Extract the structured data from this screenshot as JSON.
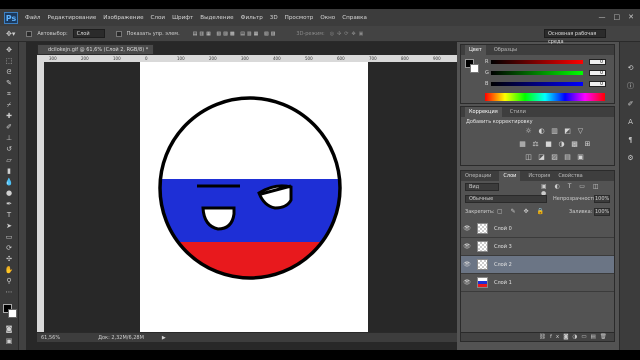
{
  "app": {
    "logo": "Ps",
    "menu": [
      "Файл",
      "Редактирование",
      "Изображение",
      "Слои",
      "Шрифт",
      "Выделение",
      "Фильтр",
      "3D",
      "Просмотр",
      "Окно",
      "Справка"
    ],
    "window_controls": [
      "—",
      "□",
      "✕"
    ]
  },
  "options_bar": {
    "autoselect_label": "Автовыбор:",
    "autoselect_value": "Слой",
    "show_controls_label": "Показать упр. элем.",
    "mode_3d_label": "3D-режим:",
    "workspace": "Основная рабочая среда"
  },
  "document": {
    "tab_title": "dcilokejn.gif @ 61,6% (Слой 2, RGB/8) *",
    "ruler_ticks": [
      "300",
      "200",
      "100",
      "0",
      "100",
      "200",
      "300",
      "400",
      "500",
      "600",
      "700",
      "800",
      "900"
    ],
    "zoom": "61,56%",
    "doc_size": "Док: 2,32M/6,28M"
  },
  "color_panel": {
    "tabs": [
      "Цвет",
      "Образцы"
    ],
    "sliders": [
      {
        "label": "R",
        "value": "0",
        "gradient": "#ff0000"
      },
      {
        "label": "G",
        "value": "0",
        "gradient": "#00ff00"
      },
      {
        "label": "B",
        "value": "0",
        "gradient": "#0000ff"
      }
    ],
    "foreground": "#000000",
    "background": "#ffffff"
  },
  "adjustments_panel": {
    "tabs": [
      "Коррекция",
      "Стили"
    ],
    "subtitle": "Добавить корректировку",
    "icons_row1": [
      "☼",
      "◐",
      "▥",
      "◩",
      "▽"
    ],
    "icons_row2": [
      "▦",
      "⚖",
      "■",
      "◑",
      "▩",
      "⊞"
    ],
    "icons_row3": [
      "◫",
      "◪",
      "▨",
      "▤",
      "▣"
    ]
  },
  "layers_panel": {
    "tabs": [
      "Операции",
      "Слои",
      "История",
      "Свойства"
    ],
    "filter": "Вид",
    "blend_mode": "Обычные",
    "opacity_label": "Непрозрачность:",
    "opacity_value": "100%",
    "lock_label": "Закрепить:",
    "fill_label": "Заливка:",
    "fill_value": "100%",
    "layers": [
      {
        "name": "Слой 0",
        "visible": true,
        "selected": false,
        "flag": false
      },
      {
        "name": "Слой 3",
        "visible": true,
        "selected": false,
        "flag": false
      },
      {
        "name": "Слой 2",
        "visible": true,
        "selected": true,
        "flag": false
      },
      {
        "name": "Слой 1",
        "visible": true,
        "selected": false,
        "flag": true
      }
    ],
    "footer_icons": [
      "⛓",
      "fx",
      "◙",
      "◑",
      "▭",
      "▤",
      "🗑"
    ]
  },
  "artwork": {
    "flag_colors": [
      "#ffffff",
      "#1e2fd6",
      "#e8191d"
    ]
  }
}
